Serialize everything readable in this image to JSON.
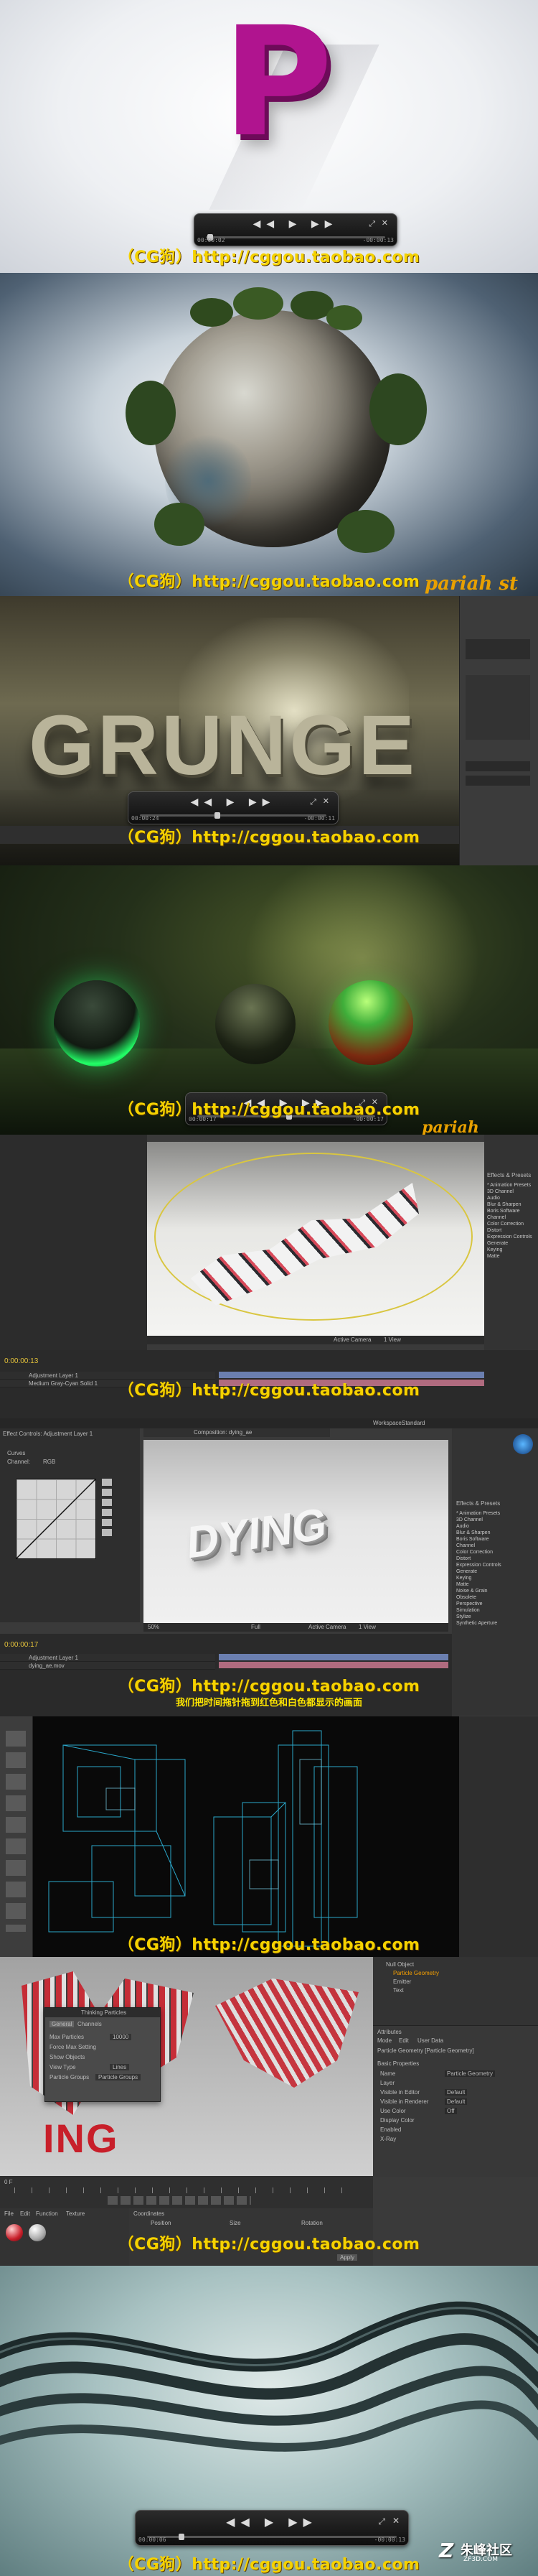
{
  "watermark": "（CG狗）http://cggou.taobao.com",
  "brand_text": "pariah st",
  "brand_text_2": "pariah",
  "logo_letter": "P",
  "grunge_text": "GRUNGE",
  "dying_text": "DYING",
  "subtitle_cn": "我们把时间拖针拖到红色和白色都显示的画面",
  "footer_logo": "朱峰社区",
  "footer_url": "ZF3D.COM",
  "player_controls": "◀◀ ▶ ▶▶",
  "ae_panels": {
    "effect_controls": "Effect Controls: Adjustment Layer 1",
    "composition": "Composition: dying_ae",
    "effects_presets": "Effects & Presets",
    "preset_items": [
      "* Animation Presets",
      "3D Channel",
      "Audio",
      "Blur & Sharpen",
      "Boris Software",
      "Channel",
      "Color Correction",
      "Distort",
      "Expression Controls",
      "Generate",
      "Keying",
      "Matte",
      "Noise & Grain",
      "Obsolete",
      "Perspective",
      "Simulation",
      "Stylize",
      "Synthetic Aperture",
      "Text",
      "Time",
      "Transition",
      "Utility"
    ],
    "timecode": "0:00:00:13",
    "timecode_2": "0:00:00:17",
    "layers": [
      "Adjustment Layer 1",
      "Medium Gray-Cyan Solid 1",
      "dying_ae.mov"
    ],
    "curves": "Curves",
    "channel": "Channel:",
    "rgb": "RGB",
    "workspace": "Workspace:",
    "standard": "Standard",
    "active_camera": "Active Camera",
    "one_view": "1 View",
    "full": "Full",
    "zoom": "50%"
  },
  "c4d_panels": {
    "dialog_title": "Thinking Particles",
    "dialog_tabs": [
      "General",
      "Channels"
    ],
    "dialog_rows": [
      "Max Particles",
      "Force Max Setting",
      "Show Objects",
      "View Type",
      "Particle Groups"
    ],
    "dialog_values": [
      "10000",
      "",
      "",
      "Lines",
      "Particle Groups"
    ],
    "objects": [
      "Null Object",
      "Particle Geometry",
      "Emitter",
      "Text"
    ],
    "attributes": "Attributes",
    "attr_menu": [
      "Mode",
      "Edit",
      "User Data"
    ],
    "object_title": "Particle Geometry [Particle Geometry]",
    "basic": "Basic Properties",
    "basic_rows": [
      "Name",
      "Layer",
      "Visible in Editor",
      "Visible in Renderer",
      "Use Color",
      "Display Color",
      "Enabled",
      "X-Ray"
    ],
    "basic_values": [
      "Particle Geometry",
      "",
      "Default",
      "Default",
      "Off",
      "",
      "",
      ""
    ],
    "coords_title": "Coordinates",
    "coord_headers": [
      "Position",
      "Size",
      "Rotation"
    ],
    "apply": "Apply",
    "menu": [
      "File",
      "Edit",
      "Function",
      "Texture"
    ],
    "frame": "0 F"
  },
  "timecodes": {
    "p1_left": "00:00:02",
    "p1_right": "-00:00:13",
    "p3_left": "00:00:24",
    "p3_right": "-00:00:11",
    "p4_left": "00:00:17",
    "p4_right": "-00:00:17",
    "p10_left": "00:00:06",
    "p10_right": "-00:00:13"
  }
}
